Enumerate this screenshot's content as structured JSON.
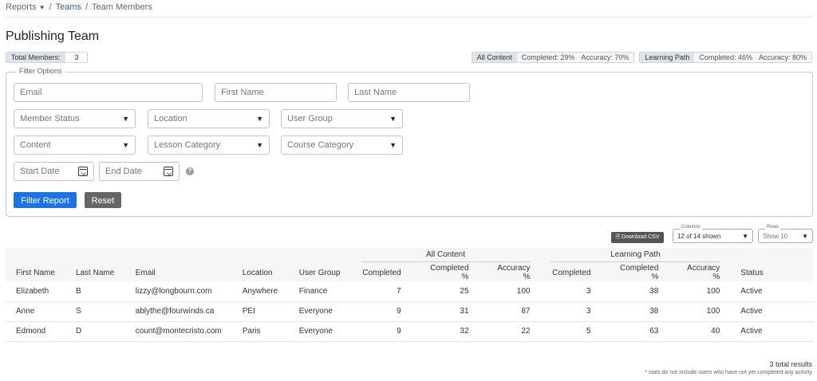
{
  "breadcrumb": {
    "reports": "Reports",
    "teams": "Teams",
    "current": "Team Members",
    "sep": "/"
  },
  "page": {
    "title": "Publishing Team"
  },
  "total_members": {
    "label": "Total Members:",
    "value": "3"
  },
  "stats": {
    "all_content": {
      "label": "All Content",
      "completed": "Completed: 29%",
      "accuracy": "Accuracy: 70%"
    },
    "learning_path": {
      "label": "Learning Path",
      "completed": "Completed: 46%",
      "accuracy": "Accuracy: 80%"
    }
  },
  "filter": {
    "legend": "Filter Options",
    "email_placeholder": "Email",
    "first_name_placeholder": "First Name",
    "last_name_placeholder": "Last Name",
    "member_status": "Member Status",
    "location": "Location",
    "user_group": "User Group",
    "content": "Content",
    "lesson_category": "Lesson Category",
    "course_category": "Course Category",
    "start_date": "Start Date",
    "end_date": "End Date",
    "help": "?",
    "filter_button": "Filter Report",
    "reset_button": "Reset"
  },
  "controls": {
    "download_csv": "🗎 Download CSV",
    "columns_label": "Columns",
    "columns_value": "12 of 14 shown",
    "rows_label": "Rows",
    "rows_value": "Show 10"
  },
  "table": {
    "group_headers": {
      "all_content": "All Content",
      "learning_path": "Learning Path"
    },
    "headers": [
      "First Name",
      "Last Name",
      "Email",
      "Location",
      "User Group",
      "Completed",
      "Completed %",
      "Accuracy %",
      "Completed",
      "Completed %",
      "Accuracy %",
      "Status"
    ],
    "rows": [
      [
        "Elizabeth",
        "B",
        "lizzy@longbourn.com",
        "Anywhere",
        "Finance",
        "7",
        "25",
        "100",
        "3",
        "38",
        "100",
        "Active"
      ],
      [
        "Anne",
        "S",
        "ablythe@fourwinds.ca",
        "PEI",
        "Everyone",
        "9",
        "31",
        "87",
        "3",
        "38",
        "100",
        "Active"
      ],
      [
        "Edmond",
        "D",
        "count@montecristo.com",
        "Paris",
        "Everyone",
        "9",
        "32",
        "22",
        "5",
        "63",
        "40",
        "Active"
      ]
    ]
  },
  "footer": {
    "total_results": "3 total results",
    "note": "* stats do not include users who have not yet completed any activity"
  },
  "icons": {
    "caret": "▼",
    "calendar": "calendar-icon",
    "download": "file-icon"
  }
}
